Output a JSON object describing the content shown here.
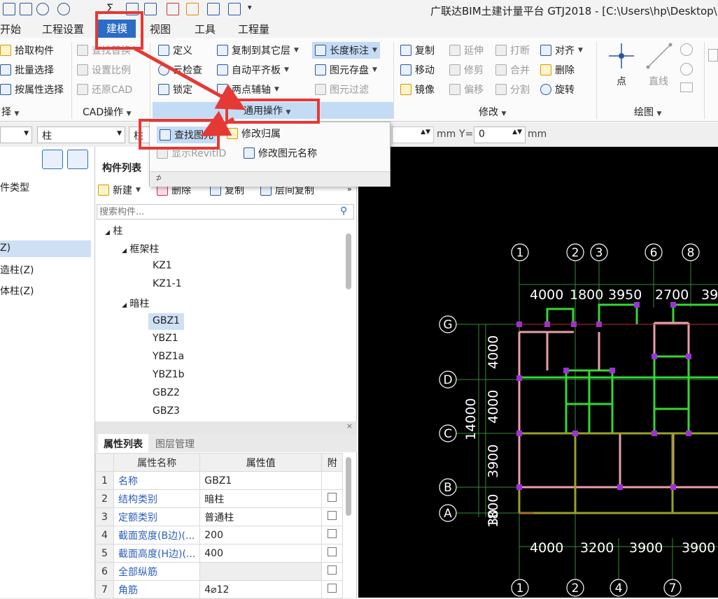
{
  "window": {
    "title": "广联达BIM土建计量平台 GTJ2018 - [C:\\Users\\hp\\Desktop\\"
  },
  "menu": {
    "items": [
      "开始",
      "工程设置",
      "建模",
      "视图",
      "工具",
      "工程量"
    ],
    "active": "建模"
  },
  "ribbon": {
    "select": {
      "pick": "拾取构件",
      "batch": "批量选择",
      "by_attr": "按属性选择",
      "label": "择"
    },
    "cad": {
      "find_replace": "查找替换",
      "scale": "设置比例",
      "restore": "还原CAD",
      "label": "CAD操作"
    },
    "general": {
      "define": "定义",
      "check": "云检查",
      "lock": "锁定",
      "copy_floor": "复制到其它层",
      "auto_align": "自动平齐板",
      "two_point_axis": "两点辅轴",
      "dimension": "长度标注",
      "save_elements": "图元存盘",
      "filter": "图元过滤",
      "label": "通用操作"
    },
    "modify": {
      "copy": "复制",
      "extend": "延伸",
      "break": "打断",
      "align": "对齐",
      "move": "移动",
      "trim": "修剪",
      "merge": "合并",
      "delete": "删除",
      "mirror": "镜像",
      "offset": "偏移",
      "split": "分割",
      "rotate": "旋转",
      "label": "修改"
    },
    "draw": {
      "point": "点",
      "line": "直线",
      "label": "绘图"
    }
  },
  "toolbar": {
    "combo2": "柱",
    "combo3": "柱",
    "mm1": "mm",
    "y_label": "Y=",
    "y_value": "0",
    "mm2": "mm"
  },
  "dropdown": {
    "find": "查找图元",
    "modify_owner": "修改归属",
    "show_revit": "显示RevitID",
    "rename": "修改图元名称"
  },
  "left_panel": {
    "items": [
      "件类型",
      "Z)",
      "造柱(Z)",
      "体柱(Z)"
    ]
  },
  "component_list": {
    "title": "构件列表",
    "actions": {
      "new": "新建",
      "delete": "删除",
      "copy": "复制",
      "floor_copy": "层间复制"
    },
    "search_placeholder": "搜索构件...",
    "tree": {
      "root": "柱",
      "frame_group": "框架柱",
      "frame_items": [
        "KZ1",
        "KZ1-1"
      ],
      "hidden_group": "暗柱",
      "hidden_items": [
        "GBZ1",
        "YBZ1",
        "YBZ1a",
        "YBZ1b",
        "GBZ2",
        "GBZ3"
      ],
      "selected": "GBZ1"
    }
  },
  "properties": {
    "tabs": [
      "属性列表",
      "图层管理"
    ],
    "headers": [
      "属性名称",
      "属性值",
      "附"
    ],
    "rows": [
      {
        "n": "1",
        "name": "名称",
        "value": "GBZ1"
      },
      {
        "n": "2",
        "name": "结构类别",
        "value": "暗柱"
      },
      {
        "n": "3",
        "name": "定额类别",
        "value": "普通柱"
      },
      {
        "n": "4",
        "name": "截面宽度(B边)(...",
        "value": "200"
      },
      {
        "n": "5",
        "name": "截面高度(H边)(...",
        "value": "400"
      },
      {
        "n": "6",
        "name": "全部纵筋",
        "value": ""
      },
      {
        "n": "7",
        "name": "角筋",
        "value": "4⌀12"
      }
    ]
  },
  "cad": {
    "top_axes": [
      "1",
      "2",
      "3",
      "6",
      "8"
    ],
    "bottom_axes": [
      "1",
      "2",
      "4",
      "7"
    ],
    "left_axes": [
      "G",
      "D",
      "C",
      "B",
      "A"
    ],
    "top_dims": [
      "4000",
      "1800",
      "3950",
      "2700",
      "39"
    ],
    "bottom_dims": [
      "4000",
      "3200",
      "3900",
      "3900"
    ],
    "left_dims": [
      "4000",
      "4000",
      "3900",
      "1800"
    ],
    "total_dim": "14000",
    "extra_dim": "30"
  }
}
